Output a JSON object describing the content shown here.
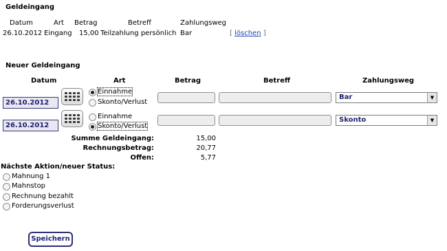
{
  "existing": {
    "heading": "Geldeingang",
    "headers": [
      "Datum",
      "Art",
      "Betrag",
      "Betreff",
      "Zahlungsweg"
    ],
    "row": {
      "datum": "26.10.2012",
      "art": "Eingang",
      "betrag": "15,00",
      "betreff": "Teilzahlung persönlich",
      "zahlungsweg": "Bar",
      "bracket_open": "[",
      "delete_label": "löschen",
      "bracket_close": "]"
    }
  },
  "new_entry": {
    "heading": "Neuer Geldeingang",
    "headers": [
      "Datum",
      "Art",
      "Betrag",
      "Betreff",
      "Zahlungsweg"
    ],
    "rows": [
      {
        "date": "26.10.2012",
        "option1": "Einnahme",
        "option2": "Skonto/Verlust",
        "selected": "Einnahme",
        "betrag": "",
        "betreff": "",
        "zahlungsweg": "Bar"
      },
      {
        "date": "26.10.2012",
        "option1": "Einnahme",
        "option2": "Skonto/Verlust",
        "selected": "Skonto/Verlust",
        "betrag": "",
        "betreff": "",
        "zahlungsweg": "Skonto"
      }
    ]
  },
  "summary": [
    {
      "label": "Summe Geldeingang:",
      "value": "15,00"
    },
    {
      "label": "Rechnungsbetrag:",
      "value": "20,77"
    },
    {
      "label": "Offen:",
      "value": "5,77"
    }
  ],
  "next_action": {
    "heading": "Nächste Aktion/neuer Status:",
    "options": [
      "Mahnung 1",
      "Mahnstop",
      "Rechnung bezahlt",
      "Forderungsverlust"
    ]
  },
  "save_label": "Speichern",
  "icons": {
    "calendar": "calendar-icon",
    "dropdown": "chevron-down-icon"
  }
}
